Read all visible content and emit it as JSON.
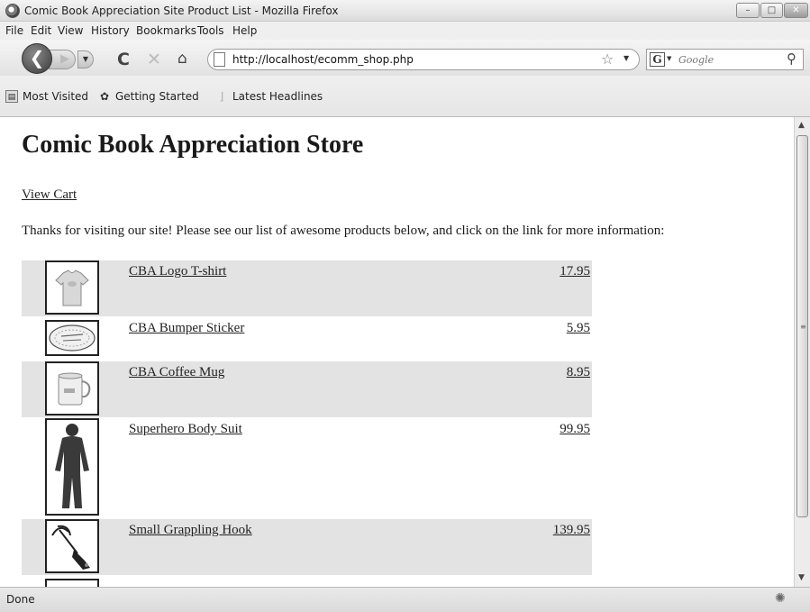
{
  "window": {
    "title": "Comic Book Appreciation Site Product List - Mozilla Firefox"
  },
  "menu": [
    "File",
    "Edit",
    "View",
    "History",
    "Bookmarks",
    "Tools",
    "Help"
  ],
  "nav": {
    "url": "http://localhost/ecomm_shop.php",
    "search_placeholder": "Google"
  },
  "bookmarks": [
    "Most Visited",
    "Getting Started",
    "Latest Headlines"
  ],
  "page": {
    "title": "Comic Book Appreciation Store",
    "view_cart": "View Cart",
    "intro": "Thanks for visiting our site! Please see our list of awesome products below, and click on the link for more information:",
    "products": [
      {
        "name": "CBA Logo T-shirt",
        "price": "17.95",
        "icon": "t-shirt"
      },
      {
        "name": "CBA Bumper Sticker",
        "price": "5.95",
        "icon": "bumper-sticker"
      },
      {
        "name": "CBA Coffee Mug",
        "price": "8.95",
        "icon": "coffee-mug"
      },
      {
        "name": "Superhero Body Suit",
        "price": "99.95",
        "icon": "body-suit"
      },
      {
        "name": "Small Grappling Hook",
        "price": "139.95",
        "icon": "grappling-hook"
      }
    ]
  },
  "status": {
    "text": "Done"
  }
}
